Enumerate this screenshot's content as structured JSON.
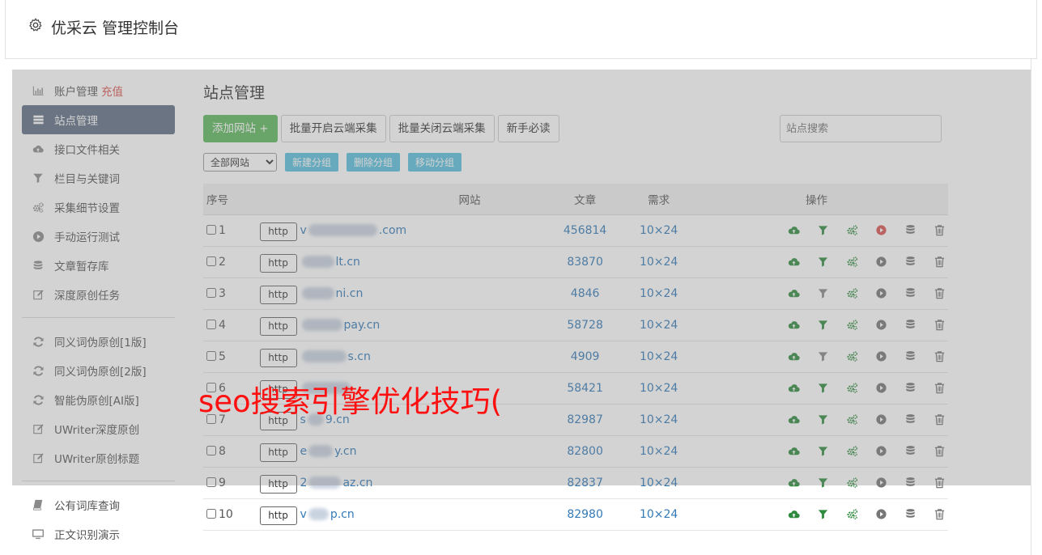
{
  "app": {
    "title": "优采云 管理控制台",
    "icon": "gear-icon"
  },
  "sidebar": {
    "items": [
      {
        "label": "账户管理",
        "extra": "充值",
        "icon": "bar-chart-icon",
        "active": false
      },
      {
        "label": "站点管理",
        "icon": "server-list-icon",
        "active": true
      },
      {
        "label": "接口文件相关",
        "icon": "cloud-upload-icon",
        "active": false
      },
      {
        "label": "栏目与关键词",
        "icon": "filter-icon",
        "active": false
      },
      {
        "label": "采集细节设置",
        "icon": "cogs-icon",
        "active": false
      },
      {
        "label": "手动运行测试",
        "icon": "play-circle-icon",
        "active": false
      },
      {
        "label": "文章暂存库",
        "icon": "database-icon",
        "active": false
      },
      {
        "label": "深度原创任务",
        "icon": "edit-icon",
        "active": false
      }
    ],
    "items2": [
      {
        "label": "同义词伪原创[1版]",
        "icon": "refresh-icon"
      },
      {
        "label": "同义词伪原创[2版]",
        "icon": "refresh-icon"
      },
      {
        "label": "智能伪原创[AI版]",
        "icon": "refresh-icon"
      },
      {
        "label": "UWriter深度原创",
        "icon": "edit-icon"
      },
      {
        "label": "UWriter原创标题",
        "icon": "edit-icon"
      }
    ],
    "items3": [
      {
        "label": "公有词库查询",
        "icon": "book-icon"
      },
      {
        "label": "正文识别演示",
        "icon": "monitor-icon"
      }
    ]
  },
  "main": {
    "heading": "站点管理",
    "toolbar": {
      "add_site": "添加网站 +",
      "batch_open": "批量开启云端采集",
      "batch_close": "批量关闭云端采集",
      "beginner": "新手必读"
    },
    "search_placeholder": "站点搜索",
    "filter": {
      "select_value": "全部网站",
      "new_group": "新建分组",
      "delete_group": "删除分组",
      "move_group": "移动分组"
    },
    "table": {
      "headers": {
        "no": "序号",
        "site": "网站",
        "articles": "文章",
        "demand": "需求",
        "ops": "操作"
      },
      "http_label": "http",
      "rows": [
        {
          "no": "1",
          "prefix": "v",
          "suffix": ".com",
          "articles": "456814",
          "demand": "10×24",
          "active_play": true,
          "filter_on": true
        },
        {
          "no": "2",
          "prefix": "",
          "suffix": "lt.cn",
          "articles": "83870",
          "demand": "10×24",
          "active_play": false,
          "filter_on": true
        },
        {
          "no": "3",
          "prefix": "",
          "suffix": "ni.cn",
          "articles": "4846",
          "demand": "10×24",
          "active_play": false,
          "filter_on": false
        },
        {
          "no": "4",
          "prefix": "",
          "suffix": "pay.cn",
          "articles": "58728",
          "demand": "10×24",
          "active_play": false,
          "filter_on": true
        },
        {
          "no": "5",
          "prefix": "",
          "suffix": "s.cn",
          "articles": "4909",
          "demand": "10×24",
          "active_play": false,
          "filter_on": false
        },
        {
          "no": "6",
          "prefix": "",
          "suffix": "",
          "articles": "58421",
          "demand": "10×24",
          "active_play": false,
          "filter_on": true
        },
        {
          "no": "7",
          "prefix": "s",
          "suffix": "9.cn",
          "articles": "82987",
          "demand": "10×24",
          "active_play": false,
          "filter_on": true
        },
        {
          "no": "8",
          "prefix": "e",
          "suffix": "y.cn",
          "articles": "82800",
          "demand": "10×24",
          "active_play": false,
          "filter_on": true
        },
        {
          "no": "9",
          "prefix": "2",
          "suffix": "az.cn",
          "articles": "82837",
          "demand": "10×24",
          "active_play": false,
          "filter_on": true
        },
        {
          "no": "10",
          "prefix": "v",
          "suffix": "p.cn",
          "articles": "82980",
          "demand": "10×24",
          "active_play": false,
          "filter_on": true
        }
      ]
    }
  },
  "watermark": "seo搜索引擎优化技巧(",
  "colors": {
    "active_nav": "#5f6e83",
    "green": "#5cb85c",
    "info": "#5bc0de",
    "link": "#337ab7",
    "danger": "#d9534f",
    "icon_green": "#2e8b3d"
  }
}
